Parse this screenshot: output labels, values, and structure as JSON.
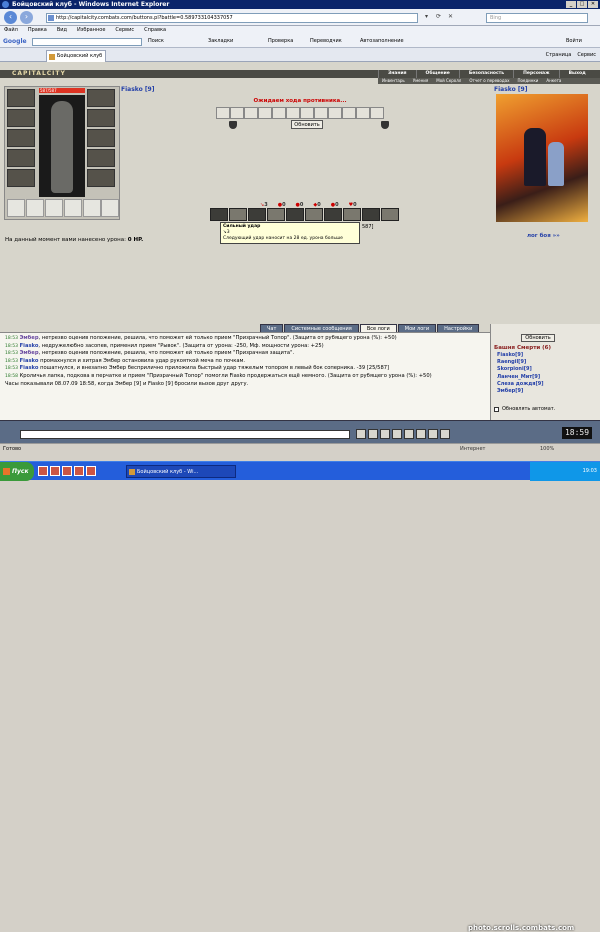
{
  "window": {
    "title": "Бойцовский клуб - Windows Internet Explorer"
  },
  "browser": {
    "url": "http://capitalcity.combats.com/buttons.pl?battle=0.589733104337057",
    "search_placeholder": "Bing",
    "menu": [
      "Файл",
      "Правка",
      "Вид",
      "Избранное",
      "Сервис",
      "Справка"
    ],
    "google": {
      "logo": "Google",
      "search_btn": "Поиск",
      "bookmarks": "Закладки",
      "check": "Проверка",
      "translate": "Переводчик",
      "autofill": "Автозаполнение",
      "login": "Войти"
    },
    "tab_title": "Бойцовский клуб",
    "tab_tools": [
      "Страница",
      "Сервис"
    ]
  },
  "game": {
    "logo": "CAPITALCITY",
    "nav_main": [
      "Знания",
      "Общение",
      "Безопасность",
      "Персонаж",
      "Выход"
    ],
    "nav_sub": [
      "Инвентарь",
      "Умения",
      "Мой Скролл",
      "Отчет о переводах",
      "Поединки",
      "Анкета"
    ],
    "player": {
      "name": "Fiasko [9]",
      "hp": "587/587"
    },
    "enemy": {
      "name": "Fiasko [9]"
    },
    "waiting": "Ожидаем хода противника...",
    "refresh_label": "Обновить",
    "counters": [
      {
        "icon": "↘",
        "val": "3"
      },
      {
        "icon": "●",
        "val": "0"
      },
      {
        "icon": "●",
        "val": "0"
      },
      {
        "icon": "◆",
        "val": "0"
      },
      {
        "icon": "●",
        "val": "0"
      },
      {
        "icon": "♥",
        "val": "0"
      }
    ],
    "tooltip": {
      "title": "Сильный удар",
      "count": "↘3",
      "desc": "Следующий удар наносит на 28 ед. урона больше"
    },
    "tooltip_ref": "587]",
    "damage_prefix": "На данный момент вами нанесено урона:",
    "damage_value": "0 HP.",
    "battle_log": "лог боя »»"
  },
  "chat": {
    "tabs": [
      "Чат",
      "Системные сообщения",
      "Все логи",
      "Мои логи",
      "Настройки"
    ],
    "active_tab": "Все логи",
    "lines": [
      {
        "time": "18:53",
        "name": "Эмбер",
        "text": ", нетрезво оценив положение, решила, что поможет ей только прием \"Призрачный Топор\". (Защита от рубящего урона (%): +50)"
      },
      {
        "time": "18:53",
        "name": "Fiasko",
        "text": ", недружелюбно засопев, применил прием \"Рывок\". (Защита от урона: -250, Мф. мощности урона: +25)"
      },
      {
        "time": "18:53",
        "name": "Эмбер",
        "text": ", нетрезво оценив положение, решила, что поможет ей только прием \"Призрачная защита\"."
      },
      {
        "time": "18:53",
        "name": "Fiasko",
        "text": " промахнулся и хитрая Эмбер остановила удар рукояткой меча по почкам."
      },
      {
        "time": "18:53",
        "name": "Fiasko",
        "text": " пошатнулся, и внезапно Эмбер бесприличнo приложила быстрый удар тяжелым топором в левый бок соперника. -39 [25/587]"
      },
      {
        "time": "18:58",
        "name": "",
        "text": "Кроличья лапка, подкова в перчатке и прием \"Призрачный Топор\" помогли Fiasko продержаться ещё немного. (Защита от рубящего урона (%): +50)"
      },
      {
        "time": "",
        "name": "",
        "text": "Часы показывали 08.07.09 18:58, когда Эмбер [9] и Fiasko [9] бросили вызов друг другу."
      }
    ]
  },
  "side": {
    "refresh": "Обновить",
    "title": "Башня Смерти (6)",
    "users": [
      "Fiasko[9]",
      "Raengil[9]",
      "Skorpioni[9]",
      "Ланчен_Мит[9]",
      "Слеза дождя[9]",
      "Эмбер[9]"
    ],
    "auto_label": "Обновлять автомат."
  },
  "clock": "18:59",
  "status": {
    "text": "Готово",
    "zone": "Интернет",
    "zoom": "100%"
  },
  "taskbar": {
    "start": "Пуск",
    "item": "Бойцовский клуб - Wi...",
    "tray": "19:03"
  },
  "watermark": "photo.scrolls.combats.com"
}
